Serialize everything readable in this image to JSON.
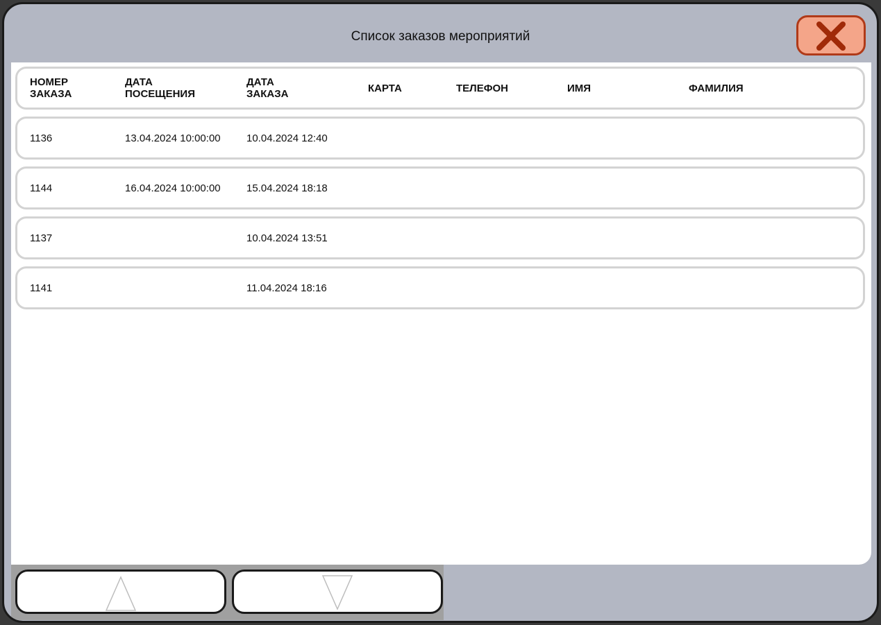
{
  "window": {
    "title": "Список заказов мероприятий"
  },
  "icons": {
    "close": "close-x-icon",
    "scroll_up": "triangle-up-icon",
    "scroll_down": "triangle-down-icon"
  },
  "colors": {
    "background": "#b3b7c3",
    "close_fill": "#f4a589",
    "close_border": "#b03a18",
    "close_glyph": "#a02a08"
  },
  "table": {
    "columns": [
      "НОМЕР\nЗАКАЗА",
      "ДАТА\nПОСЕЩЕНИЯ",
      "ДАТА\nЗАКАЗА",
      "КАРТА",
      "ТЕЛЕФОН",
      "ИМЯ",
      "ФАМИЛИЯ"
    ],
    "rows": [
      [
        "1136",
        "13.04.2024 10:00:00",
        "10.04.2024 12:40",
        "",
        "",
        "",
        ""
      ],
      [
        "1144",
        "16.04.2024 10:00:00",
        "15.04.2024 18:18",
        "",
        "",
        "",
        ""
      ],
      [
        "1137",
        "",
        "10.04.2024 13:51",
        "",
        "",
        "",
        ""
      ],
      [
        "1141",
        "",
        "11.04.2024 18:16",
        "",
        "",
        "",
        ""
      ]
    ]
  }
}
